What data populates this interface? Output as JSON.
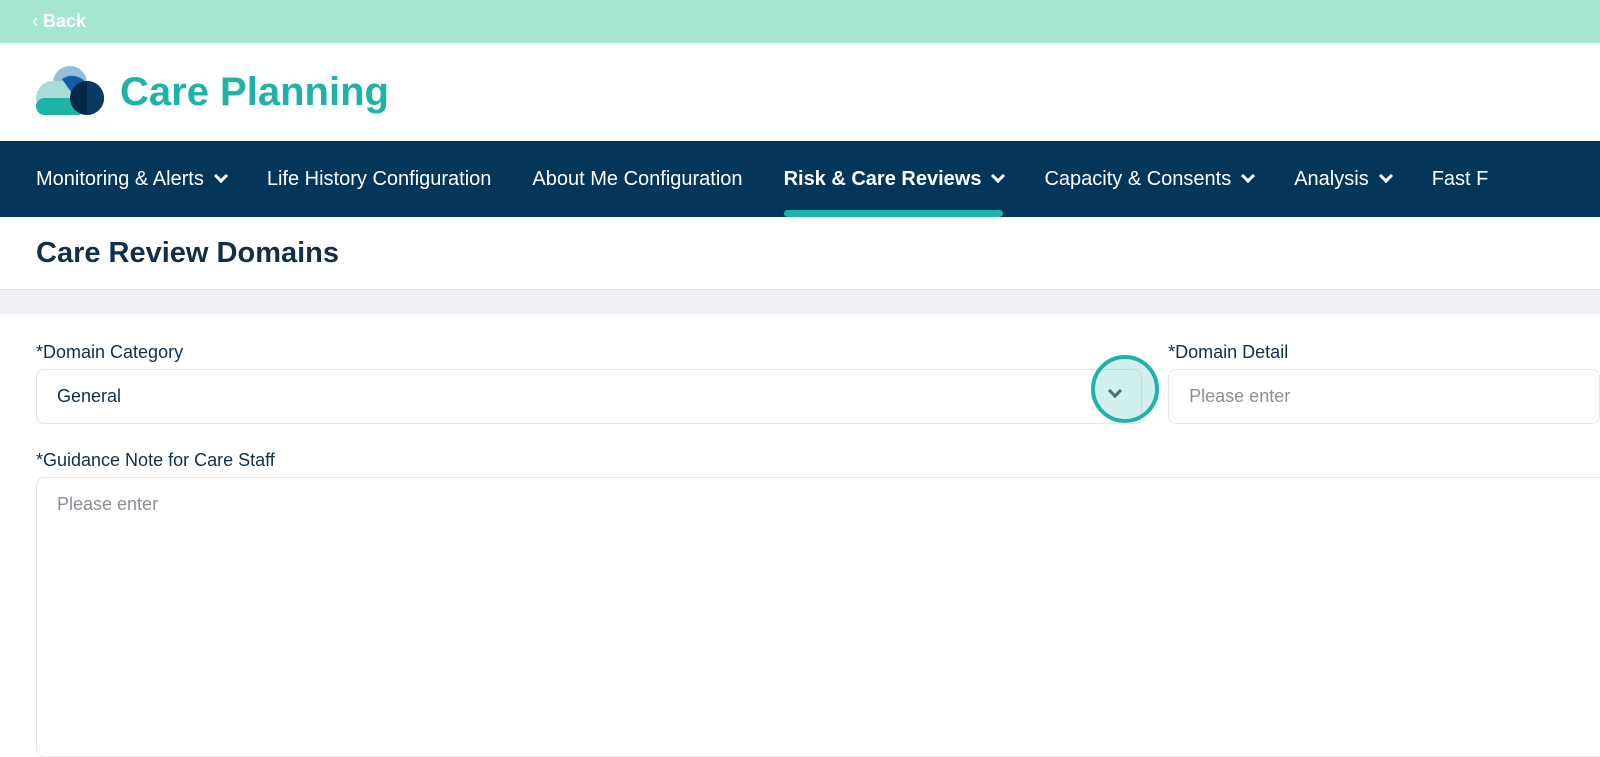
{
  "topbar": {
    "back_label": "‹ Back"
  },
  "header": {
    "title": "Care Planning"
  },
  "nav": {
    "items": [
      {
        "label": "Monitoring & Alerts",
        "dropdown": true
      },
      {
        "label": "Life History Configuration",
        "dropdown": false
      },
      {
        "label": "About Me Configuration",
        "dropdown": false
      },
      {
        "label": "Risk & Care Reviews",
        "dropdown": true,
        "active": true
      },
      {
        "label": "Capacity & Consents",
        "dropdown": true
      },
      {
        "label": "Analysis",
        "dropdown": true
      },
      {
        "label": "Fast F",
        "dropdown": false
      }
    ]
  },
  "page": {
    "title": "Care Review Domains"
  },
  "form": {
    "domain_category": {
      "label": "*Domain Category",
      "value": "General"
    },
    "domain_detail": {
      "label": "*Domain Detail",
      "placeholder": "Please enter"
    },
    "guidance": {
      "label": "*Guidance Note for Care Staff",
      "placeholder": "Please enter"
    }
  },
  "colors": {
    "accent": "#1fb3a8",
    "nav_bg": "#03365a",
    "topbar": "#a5e6d0"
  }
}
